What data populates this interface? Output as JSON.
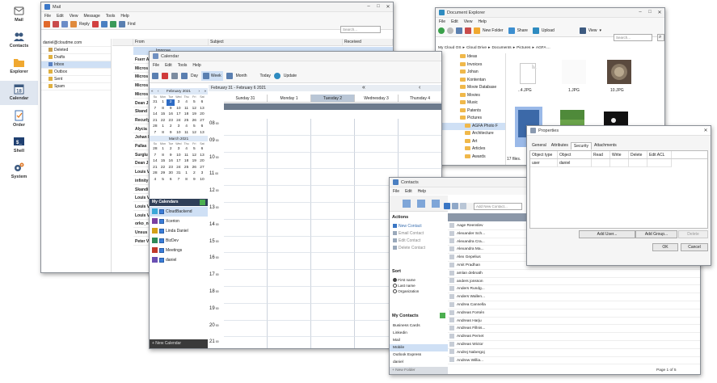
{
  "sidebar": {
    "items": [
      {
        "label": "Mail",
        "icon": "mail-icon",
        "active": false
      },
      {
        "label": "Contacts",
        "icon": "contacts-icon",
        "active": false
      },
      {
        "label": "Explorer",
        "icon": "folder-icon",
        "active": false
      },
      {
        "label": "Calendar",
        "icon": "calendar-icon",
        "active": true
      },
      {
        "label": "Order",
        "icon": "order-icon",
        "active": false
      },
      {
        "label": "Shell",
        "icon": "shell-icon",
        "active": false
      },
      {
        "label": "System",
        "icon": "gear-icon",
        "active": false
      }
    ]
  },
  "mail": {
    "title": "Mail",
    "menu": [
      "File",
      "Edit",
      "View",
      "Message",
      "Tools",
      "Help"
    ],
    "toolbar": {
      "reply": "Reply",
      "find": "Find"
    },
    "search_placeholder": "Search...",
    "account": "daniel@cloudme.com",
    "folders": [
      "Deleted",
      "Drafts",
      "Inbox",
      "Outbox",
      "Sent",
      "Spam"
    ],
    "columns": {
      "from": "From",
      "subject": "Subject",
      "received": "Received"
    },
    "first_subject": "Improve",
    "senders": [
      "Fserr A",
      "Micros",
      "Micros",
      "Micros",
      "Micros",
      "Dean J",
      "Skand",
      "Recurly",
      "Alycia",
      "Johan L",
      "Pallas",
      "Surglu",
      "Dean J",
      "Louis V",
      "infinity",
      "Skandi",
      "Louis V",
      "Louis V",
      "Louis V",
      "orko_n",
      "Unsus",
      "Peter V"
    ]
  },
  "calendar": {
    "title": "Calendar",
    "menu": [
      "File",
      "Edit",
      "Tools",
      "Help"
    ],
    "toolbar": {
      "day": "Day",
      "week": "Week",
      "month": "Month",
      "today": "Today",
      "update": "Update"
    },
    "range": "February 31 - February 6 2021",
    "mini1": {
      "title": "February 2021",
      "days": [
        "Su",
        "Mon",
        "Tue",
        "Wed",
        "Thu",
        "Fri",
        "Sat"
      ],
      "rows": [
        [
          "31",
          "1",
          "2",
          "3",
          "4",
          "5",
          "6"
        ],
        [
          "7",
          "8",
          "9",
          "10",
          "11",
          "12",
          "13"
        ],
        [
          "14",
          "15",
          "16",
          "17",
          "18",
          "19",
          "20"
        ],
        [
          "21",
          "22",
          "23",
          "24",
          "25",
          "26",
          "27"
        ],
        [
          "28",
          "1",
          "2",
          "3",
          "4",
          "5",
          "6"
        ],
        [
          "7",
          "8",
          "9",
          "10",
          "11",
          "12",
          "13"
        ]
      ],
      "selected": "2"
    },
    "mini2": {
      "title": "March 2021",
      "rows": [
        [
          "28",
          "1",
          "2",
          "3",
          "4",
          "5",
          "6"
        ],
        [
          "7",
          "8",
          "9",
          "10",
          "11",
          "12",
          "13"
        ],
        [
          "14",
          "15",
          "16",
          "17",
          "18",
          "19",
          "20"
        ],
        [
          "21",
          "22",
          "23",
          "24",
          "25",
          "26",
          "27"
        ],
        [
          "28",
          "29",
          "30",
          "31",
          "1",
          "2",
          "3"
        ],
        [
          "4",
          "5",
          "6",
          "7",
          "8",
          "9",
          "10"
        ]
      ]
    },
    "my_calendars_label": "My Calendars",
    "calendars": [
      {
        "name": "CloudBackend",
        "color": "#3aa7d8"
      },
      {
        "name": "Xcerion",
        "color": "#7b3fa0"
      },
      {
        "name": "Linda Daniel",
        "color": "#d4a017"
      },
      {
        "name": "BizDev",
        "color": "#2e8b57"
      },
      {
        "name": "Meetings",
        "color": "#c0392b"
      },
      {
        "name": "daniel",
        "color": "#6a4fb3"
      }
    ],
    "new_calendar": "+ New Calendar",
    "week_days": [
      "Sunday 31",
      "Monday 1",
      "Tuesday 2",
      "Wednesday 3",
      "Thursday 4"
    ],
    "hours": [
      "08",
      "09",
      "10",
      "11",
      "12",
      "13",
      "14",
      "15",
      "16",
      "17",
      "18",
      "19",
      "20",
      "21"
    ],
    "hour_suffix": "00"
  },
  "explorer": {
    "title": "Document Explorer",
    "menu": [
      "File",
      "Edit",
      "View",
      "Help"
    ],
    "toolbar": {
      "new_folder": "New Folder",
      "share": "Share",
      "upload": "Upload",
      "view": "View"
    },
    "search_placeholder": "Search...",
    "breadcrumb": [
      "My Cloud OS",
      "Cloud Drive",
      "Documents",
      "Pictures",
      "AGFA ..."
    ],
    "tree": [
      "Ideas",
      "Invoices",
      "Johan",
      "Kontentan",
      "Movie Database",
      "Movies",
      "Music",
      "Patents",
      "Pictures",
      "AGFA Photo F",
      "Architecture",
      "Art",
      "Articles",
      "Awards"
    ],
    "files": [
      "..4.JPG",
      "1.JPG",
      "10.JPG"
    ],
    "status": "17 files."
  },
  "properties": {
    "title": "Properties",
    "tabs": [
      "General",
      "Attributes",
      "Security",
      "Attachments"
    ],
    "active_tab": "Security",
    "columns": [
      "Object type",
      "Object",
      "Read",
      "Write",
      "Delete",
      "Edit ACL"
    ],
    "row": {
      "type": "user",
      "object": "daniel"
    },
    "add_user": "Add User...",
    "add_group": "Add Group...",
    "delete": "Delete",
    "ok": "OK",
    "cancel": "Cancel"
  },
  "contacts": {
    "title": "Contacts",
    "menu": [
      "File",
      "Edit",
      "Help"
    ],
    "add_placeholder": "Add New Contact...",
    "actions_label": "Actions",
    "actions": [
      "New Contact",
      "Email Contact",
      "Edit Contact",
      "Delete Contact"
    ],
    "sort_label": "Sort",
    "sort_options": [
      "First name",
      "Last name",
      "Organization"
    ],
    "my_contacts_label": "My Contacts",
    "groups": [
      "Business Cards",
      "Linkedin",
      "Mail",
      "Mobile",
      "Outlook Express",
      "daniel"
    ],
    "new_folder": "+ New Folder",
    "list": [
      "Aage Reenslev",
      "Alexander Sch...",
      "Alexandra Cra...",
      "Alexandra Ma...",
      "Alex Gepelius",
      "Amit Pradhan",
      "amlan debnath",
      "anders jonsson",
      "Anders Rundg...",
      "Anders Wallen...",
      "Andrea Cannella",
      "Andreas Forsén",
      "Andreas Harju",
      "Andreas Fillnis...",
      "Andreas Pernet",
      "Andreas Wictor",
      "Andrej Nabergoj",
      "Andrew Willia..."
    ],
    "page_indicator": "Page 1 of 5"
  }
}
